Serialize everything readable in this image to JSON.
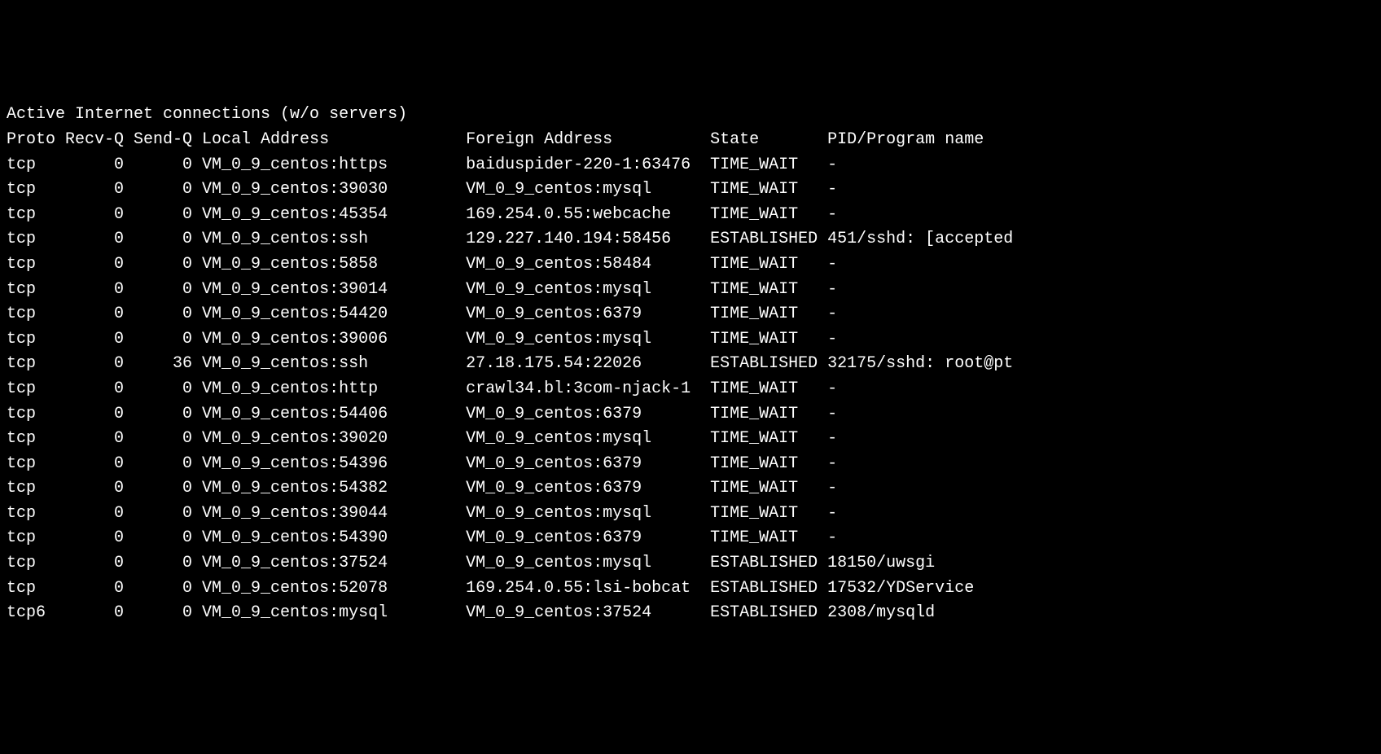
{
  "title": "Active Internet connections (w/o servers)",
  "headers": {
    "proto": "Proto",
    "recvq": "Recv-Q",
    "sendq": "Send-Q",
    "local": "Local Address",
    "foreign": "Foreign Address",
    "state": "State",
    "pid": "PID/Program name"
  },
  "rows": [
    {
      "proto": "tcp",
      "recvq": "0",
      "sendq": "0",
      "local": "VM_0_9_centos:https",
      "foreign": "baiduspider-220-1:63476",
      "state": "TIME_WAIT",
      "pid": "-"
    },
    {
      "proto": "tcp",
      "recvq": "0",
      "sendq": "0",
      "local": "VM_0_9_centos:39030",
      "foreign": "VM_0_9_centos:mysql",
      "state": "TIME_WAIT",
      "pid": "-"
    },
    {
      "proto": "tcp",
      "recvq": "0",
      "sendq": "0",
      "local": "VM_0_9_centos:45354",
      "foreign": "169.254.0.55:webcache",
      "state": "TIME_WAIT",
      "pid": "-"
    },
    {
      "proto": "tcp",
      "recvq": "0",
      "sendq": "0",
      "local": "VM_0_9_centos:ssh",
      "foreign": "129.227.140.194:58456",
      "state": "ESTABLISHED",
      "pid": "451/sshd: [accepted"
    },
    {
      "proto": "tcp",
      "recvq": "0",
      "sendq": "0",
      "local": "VM_0_9_centos:5858",
      "foreign": "VM_0_9_centos:58484",
      "state": "TIME_WAIT",
      "pid": "-"
    },
    {
      "proto": "tcp",
      "recvq": "0",
      "sendq": "0",
      "local": "VM_0_9_centos:39014",
      "foreign": "VM_0_9_centos:mysql",
      "state": "TIME_WAIT",
      "pid": "-"
    },
    {
      "proto": "tcp",
      "recvq": "0",
      "sendq": "0",
      "local": "VM_0_9_centos:54420",
      "foreign": "VM_0_9_centos:6379",
      "state": "TIME_WAIT",
      "pid": "-"
    },
    {
      "proto": "tcp",
      "recvq": "0",
      "sendq": "0",
      "local": "VM_0_9_centos:39006",
      "foreign": "VM_0_9_centos:mysql",
      "state": "TIME_WAIT",
      "pid": "-"
    },
    {
      "proto": "tcp",
      "recvq": "0",
      "sendq": "36",
      "local": "VM_0_9_centos:ssh",
      "foreign": "27.18.175.54:22026",
      "state": "ESTABLISHED",
      "pid": "32175/sshd: root@pt"
    },
    {
      "proto": "tcp",
      "recvq": "0",
      "sendq": "0",
      "local": "VM_0_9_centos:http",
      "foreign": "crawl34.bl:3com-njack-1",
      "state": "TIME_WAIT",
      "pid": "-"
    },
    {
      "proto": "tcp",
      "recvq": "0",
      "sendq": "0",
      "local": "VM_0_9_centos:54406",
      "foreign": "VM_0_9_centos:6379",
      "state": "TIME_WAIT",
      "pid": "-"
    },
    {
      "proto": "tcp",
      "recvq": "0",
      "sendq": "0",
      "local": "VM_0_9_centos:39020",
      "foreign": "VM_0_9_centos:mysql",
      "state": "TIME_WAIT",
      "pid": "-"
    },
    {
      "proto": "tcp",
      "recvq": "0",
      "sendq": "0",
      "local": "VM_0_9_centos:54396",
      "foreign": "VM_0_9_centos:6379",
      "state": "TIME_WAIT",
      "pid": "-"
    },
    {
      "proto": "tcp",
      "recvq": "0",
      "sendq": "0",
      "local": "VM_0_9_centos:54382",
      "foreign": "VM_0_9_centos:6379",
      "state": "TIME_WAIT",
      "pid": "-"
    },
    {
      "proto": "tcp",
      "recvq": "0",
      "sendq": "0",
      "local": "VM_0_9_centos:39044",
      "foreign": "VM_0_9_centos:mysql",
      "state": "TIME_WAIT",
      "pid": "-"
    },
    {
      "proto": "tcp",
      "recvq": "0",
      "sendq": "0",
      "local": "VM_0_9_centos:54390",
      "foreign": "VM_0_9_centos:6379",
      "state": "TIME_WAIT",
      "pid": "-"
    },
    {
      "proto": "tcp",
      "recvq": "0",
      "sendq": "0",
      "local": "VM_0_9_centos:37524",
      "foreign": "VM_0_9_centos:mysql",
      "state": "ESTABLISHED",
      "pid": "18150/uwsgi"
    },
    {
      "proto": "tcp",
      "recvq": "0",
      "sendq": "0",
      "local": "VM_0_9_centos:52078",
      "foreign": "169.254.0.55:lsi-bobcat",
      "state": "ESTABLISHED",
      "pid": "17532/YDService"
    },
    {
      "proto": "tcp6",
      "recvq": "0",
      "sendq": "0",
      "local": "VM_0_9_centos:mysql",
      "foreign": "VM_0_9_centos:37524",
      "state": "ESTABLISHED",
      "pid": "2308/mysqld"
    }
  ]
}
